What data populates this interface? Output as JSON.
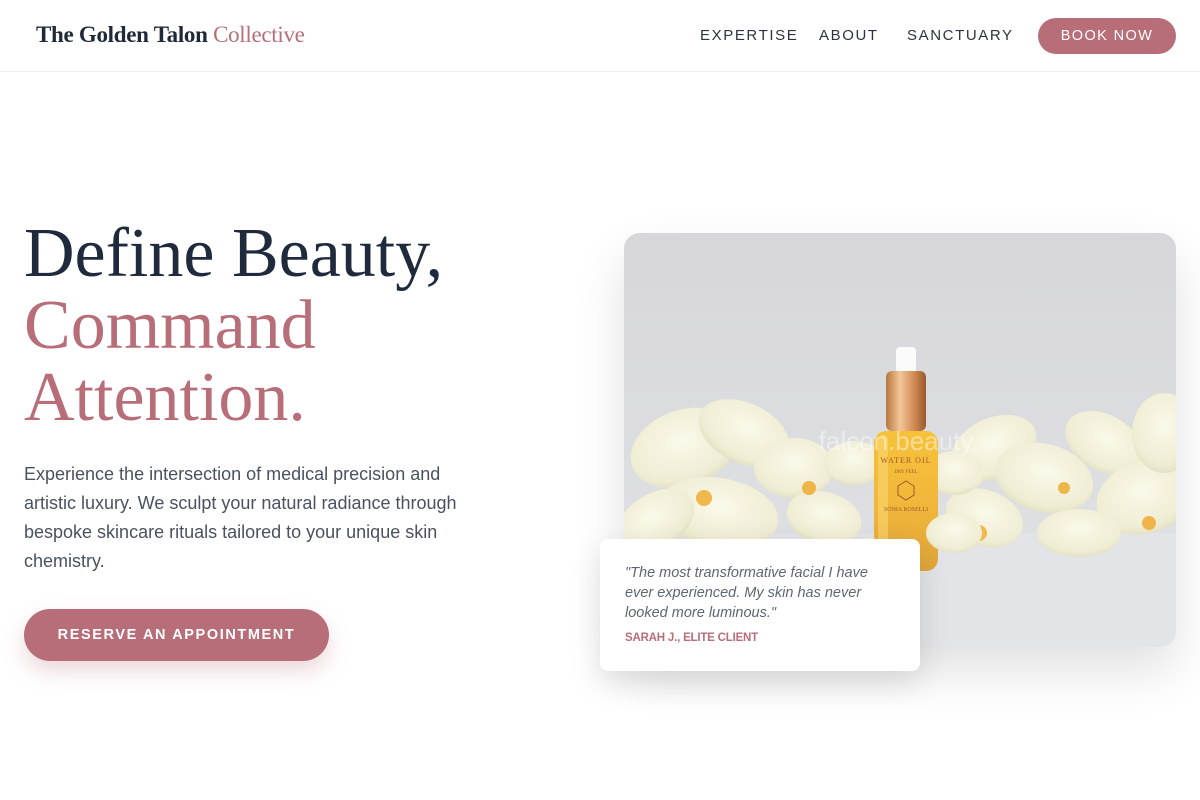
{
  "nav": {
    "logo_main": "The Golden Talon",
    "logo_accent": "Collective",
    "links": [
      "EXPERTISE",
      "ABOUT",
      "SANCTUARY"
    ],
    "cta_label": "BOOK NOW"
  },
  "hero": {
    "headline_line1": "Define Beauty,",
    "headline_line2": "Command",
    "headline_line3": "Attention.",
    "description": "Experience the intersection of medical precision and artistic luxury. We sculpt your natural radiance through bespoke skincare rituals tailored to your unique skin chemistry.",
    "cta_label": "RESERVE AN APPOINTMENT"
  },
  "product_image": {
    "bottle_label_top": "WATER OIL",
    "bottle_label_sub": "DRY FEEL",
    "bottle_brand": "SONIA ROSELLI",
    "watermark": "falcon.beauty"
  },
  "testimonial": {
    "quote": "\"The most transformative facial I have ever experienced. My skin has never looked more luminous.\"",
    "author": "SARAH J., ELITE CLIENT"
  },
  "colors": {
    "accent": "#b76e79",
    "heading": "#1f2a3c",
    "body_text": "#4a5160"
  }
}
